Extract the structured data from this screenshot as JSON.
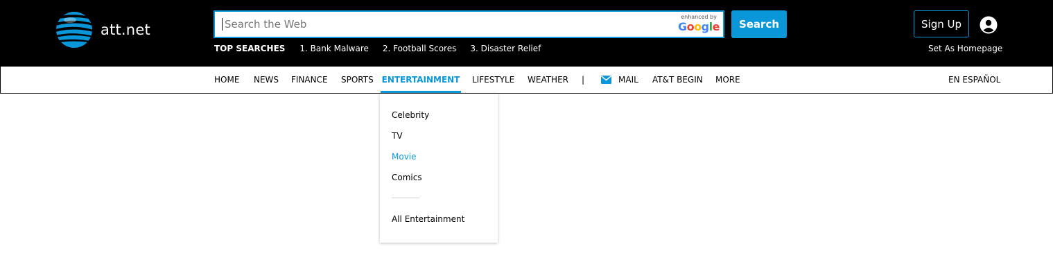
{
  "brand": {
    "name": "att.net",
    "accent": "#0a97d9"
  },
  "search": {
    "placeholder": "Search the Web",
    "enhanced_by": "enhanced by",
    "google": "Google",
    "button_label": "Search"
  },
  "top_searches": {
    "label": "TOP SEARCHES",
    "items": [
      "1. Bank Malware",
      "2. Football Scores",
      "3. Disaster Relief"
    ]
  },
  "account": {
    "signup_label": "Sign Up",
    "user_icon": "user-circle-icon",
    "set_homepage": "Set As Homepage"
  },
  "nav": {
    "items": [
      "HOME",
      "NEWS",
      "FINANCE",
      "SPORTS",
      "ENTERTAINMENT",
      "LIFESTYLE",
      "WEATHER"
    ],
    "active": "ENTERTAINMENT",
    "separator": "|",
    "mail": "MAIL",
    "att_begin": "AT&T BEGIN",
    "more": "MORE",
    "espanol": "EN ESPAÑOL"
  },
  "dropdown": {
    "items": [
      "Celebrity",
      "TV",
      "Movie",
      "Comics"
    ],
    "hovered": "Movie",
    "all": "All Entertainment"
  }
}
